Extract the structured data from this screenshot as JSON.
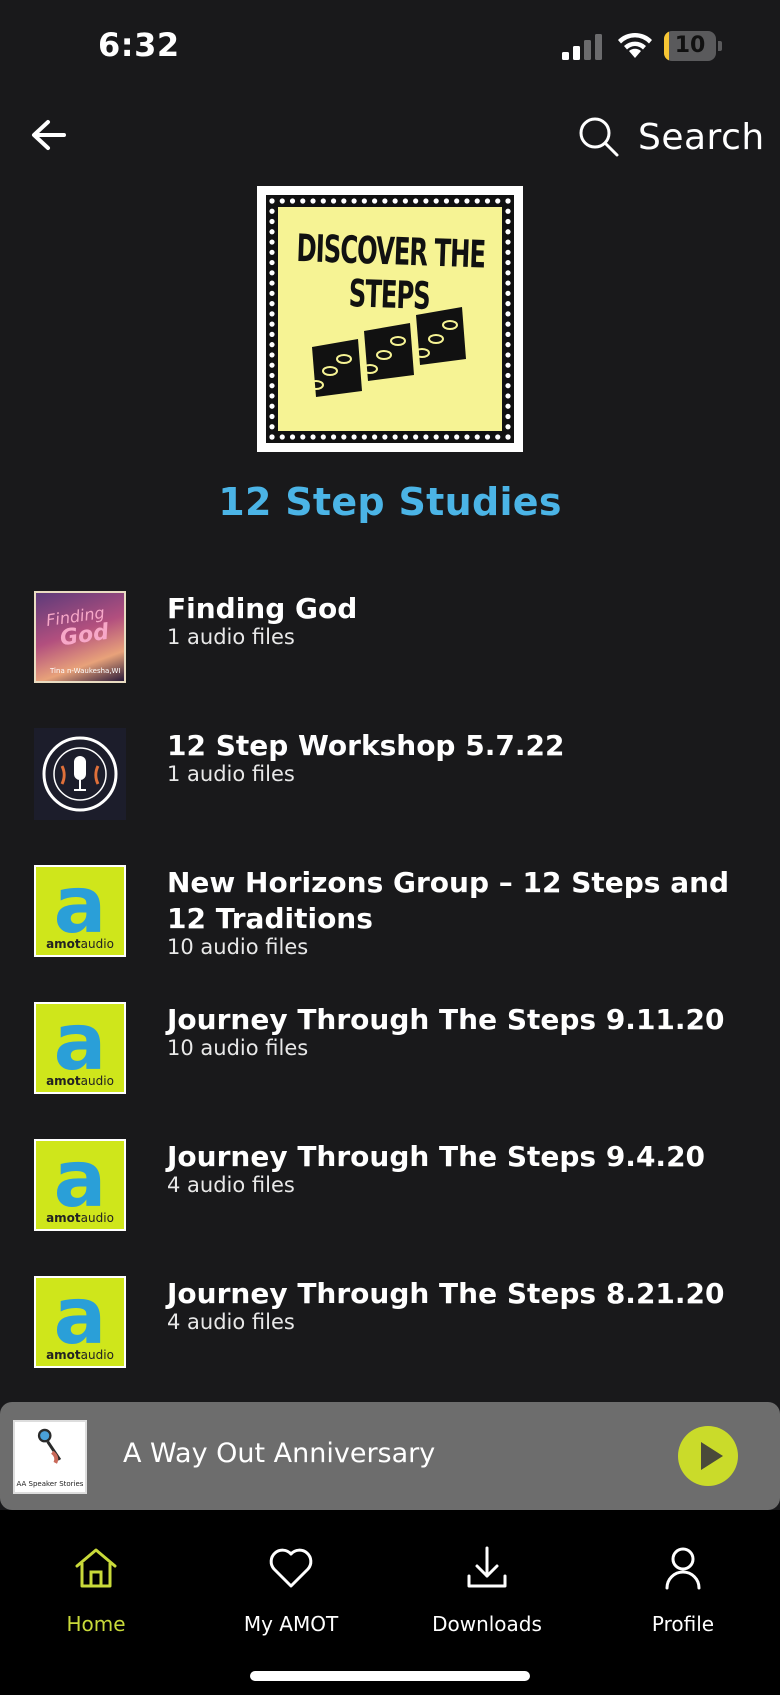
{
  "status_bar": {
    "time": "6:32",
    "battery_level": "10",
    "battery_fraction": 0.1,
    "battery_color": "#f7c634"
  },
  "header": {
    "back_icon": "arrow-left-icon",
    "search_icon": "magnifier-icon",
    "search_label": "Search"
  },
  "collection": {
    "cover_text": "DISCOVER THE STEPS",
    "title": "12 Step Studies",
    "title_color": "#4bb4e6"
  },
  "items": [
    {
      "title": "Finding God",
      "subtitle": "1 audio files",
      "thumb": "finding-god"
    },
    {
      "title": "12 Step Workshop 5.7.22",
      "subtitle": "1 audio files",
      "thumb": "microphone"
    },
    {
      "title": "New Horizons Group – 12 Steps and 12 Traditions",
      "subtitle": "10 audio files",
      "thumb": "amotaudio"
    },
    {
      "title": "Journey Through The Steps 9.11.20",
      "subtitle": "10 audio files",
      "thumb": "amotaudio"
    },
    {
      "title": "Journey Through The Steps 9.4.20",
      "subtitle": "4 audio files",
      "thumb": "amotaudio"
    },
    {
      "title": "Journey Through The Steps 8.21.20",
      "subtitle": "4 audio files",
      "thumb": "amotaudio"
    }
  ],
  "thumb_text": {
    "amot_letter": "a",
    "amot_brand_bold": "amot",
    "amot_brand_rest": "audio",
    "finding_small": "Finding",
    "finding_big": "God",
    "finding_foot": "Tina n-Waukesha,WI"
  },
  "mini_player": {
    "title": "A Way Out Anniversary",
    "thumb_caption": "AA Speaker Stories",
    "play_icon": "play-icon",
    "accent": "#cadb2a"
  },
  "tab_bar": {
    "tabs": [
      {
        "label": "Home",
        "icon": "home-icon",
        "active": true
      },
      {
        "label": "My AMOT",
        "icon": "heart-icon",
        "active": false
      },
      {
        "label": "Downloads",
        "icon": "download-icon",
        "active": false
      },
      {
        "label": "Profile",
        "icon": "person-icon",
        "active": false
      }
    ],
    "active_color": "#c9da3a"
  }
}
